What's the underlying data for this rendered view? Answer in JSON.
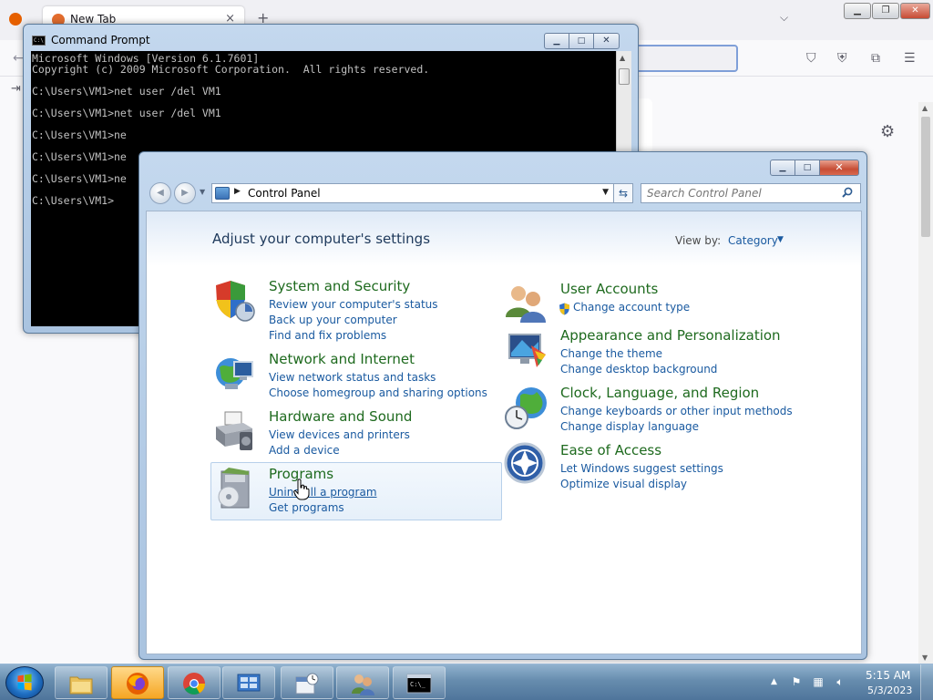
{
  "firefox": {
    "tab_title": "New Tab",
    "tab_close": "×",
    "new_tab": "+",
    "list_all": "⌵"
  },
  "cmd": {
    "title": "Command Prompt",
    "icon_text": "C:\\",
    "lines": [
      "Microsoft Windows [Version 6.1.7601]",
      "Copyright (c) 2009 Microsoft Corporation.  All rights reserved.",
      "",
      "C:\\Users\\VM1>net user /del VM1",
      "",
      "C:\\Users\\VM1>net user /del VM1",
      "",
      "C:\\Users\\VM1>ne",
      "",
      "C:\\Users\\VM1>ne",
      "",
      "C:\\Users\\VM1>ne",
      "",
      "C:\\Users\\VM1>"
    ]
  },
  "control_panel": {
    "address": "Control Panel",
    "search_placeholder": "Search Control Panel",
    "heading": "Adjust your computer's settings",
    "view_by_label": "View by:",
    "view_by_value": "Category",
    "categories": {
      "system_security": {
        "title": "System and Security",
        "links": [
          "Review your computer's status",
          "Back up your computer",
          "Find and fix problems"
        ]
      },
      "network": {
        "title": "Network and Internet",
        "links": [
          "View network status and tasks",
          "Choose homegroup and sharing options"
        ]
      },
      "hardware": {
        "title": "Hardware and Sound",
        "links": [
          "View devices and printers",
          "Add a device"
        ]
      },
      "programs": {
        "title": "Programs",
        "links": [
          "Uninstall a program",
          "Get programs"
        ]
      },
      "user_accounts": {
        "title": "User Accounts",
        "links": [
          "Change account type"
        ]
      },
      "appearance": {
        "title": "Appearance and Personalization",
        "links": [
          "Change the theme",
          "Change desktop background"
        ]
      },
      "clock": {
        "title": "Clock, Language, and Region",
        "links": [
          "Change keyboards or other input methods",
          "Change display language"
        ]
      },
      "ease": {
        "title": "Ease of Access",
        "links": [
          "Let Windows suggest settings",
          "Optimize visual display"
        ]
      }
    }
  },
  "taskbar": {
    "time": "5:15 AM",
    "date": "5/3/2023"
  }
}
